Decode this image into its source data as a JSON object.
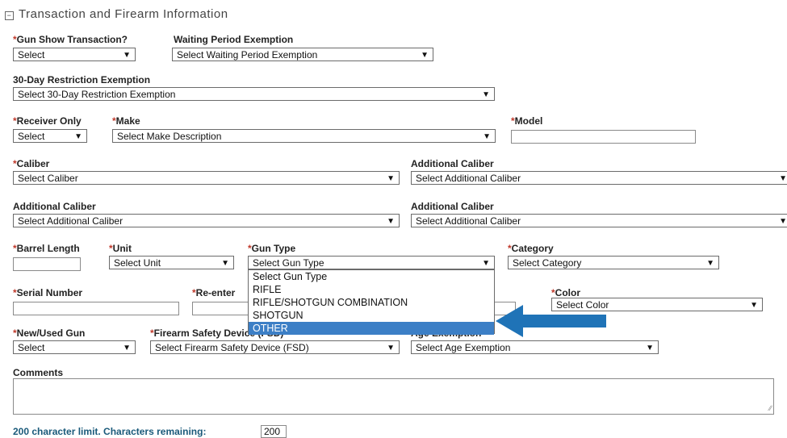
{
  "section": {
    "title": "Transaction and Firearm Information",
    "collapse_glyph": "−"
  },
  "fields": {
    "gun_show": {
      "label": "Gun Show Transaction?",
      "value": "Select"
    },
    "waiting_period": {
      "label": "Waiting Period Exemption",
      "value": "Select Waiting Period Exemption"
    },
    "restriction_30day": {
      "label": "30-Day Restriction Exemption",
      "value": "Select 30-Day Restriction Exemption"
    },
    "receiver_only": {
      "label": "Receiver Only",
      "value": "Select"
    },
    "make": {
      "label": "Make",
      "value": "Select Make Description"
    },
    "model": {
      "label": "Model",
      "value": ""
    },
    "caliber": {
      "label": "Caliber",
      "value": "Select Caliber"
    },
    "additional_caliber_1": {
      "label": "Additional Caliber",
      "value": "Select Additional Caliber"
    },
    "additional_caliber_2": {
      "label": "Additional Caliber",
      "value": "Select Additional Caliber"
    },
    "additional_caliber_3": {
      "label": "Additional Caliber",
      "value": "Select Additional Caliber"
    },
    "barrel_length": {
      "label": "Barrel Length",
      "value": ""
    },
    "unit": {
      "label": "Unit",
      "value": "Select Unit"
    },
    "gun_type": {
      "label": "Gun Type",
      "value": "Select Gun Type",
      "options": [
        "Select Gun Type",
        "RIFLE",
        "RIFLE/SHOTGUN COMBINATION",
        "SHOTGUN",
        "OTHER"
      ],
      "highlighted": "OTHER"
    },
    "category": {
      "label": "Category",
      "value": "Select Category"
    },
    "serial_number": {
      "label": "Serial Number",
      "value": ""
    },
    "reenter": {
      "label": "Re-enter",
      "value": ""
    },
    "color": {
      "label": "Color",
      "value": "Select Color"
    },
    "new_used": {
      "label": "New/Used Gun",
      "value": "Select"
    },
    "fsd": {
      "label": "Firearm Safety Device (FSD)",
      "value": "Select Firearm Safety Device (FSD)"
    },
    "age_exemption": {
      "label": "Age Exemption",
      "value": "Select Age Exemption"
    },
    "comments": {
      "label": "Comments",
      "value": ""
    },
    "char_limit": {
      "label": "200 character limit. Characters remaining:",
      "value": "200"
    }
  },
  "colors": {
    "arrow": "#1f73b7",
    "highlight": "#3c7fc6",
    "required": "#c0392b",
    "char_limit_text": "#1a5a7a"
  },
  "icons": {
    "chevron": "chevron-down-icon",
    "collapse": "collapse-icon",
    "resize": "resize-handle-icon"
  }
}
